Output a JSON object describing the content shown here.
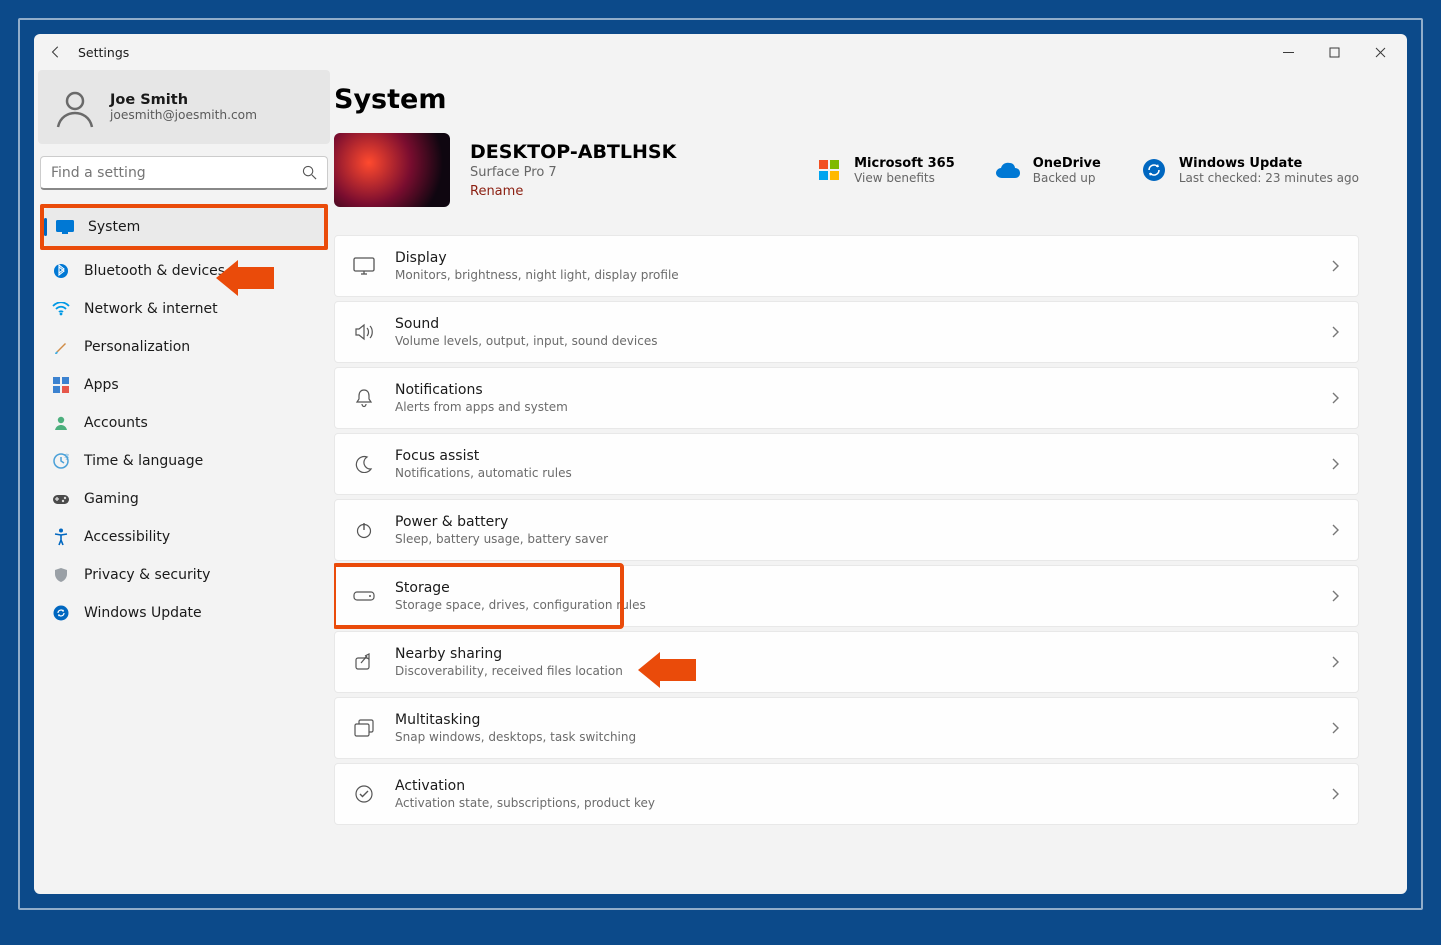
{
  "window": {
    "title": "Settings"
  },
  "profile": {
    "name": "Joe Smith",
    "email": "joesmith@joesmith.com"
  },
  "search": {
    "placeholder": "Find a setting"
  },
  "sidebar": {
    "items": [
      {
        "label": "System",
        "icon": "system",
        "active": true,
        "highlight": true
      },
      {
        "label": "Bluetooth & devices",
        "icon": "bluetooth"
      },
      {
        "label": "Network & internet",
        "icon": "wifi"
      },
      {
        "label": "Personalization",
        "icon": "brush"
      },
      {
        "label": "Apps",
        "icon": "apps"
      },
      {
        "label": "Accounts",
        "icon": "person"
      },
      {
        "label": "Time & language",
        "icon": "clock"
      },
      {
        "label": "Gaming",
        "icon": "gamepad"
      },
      {
        "label": "Accessibility",
        "icon": "accessibility"
      },
      {
        "label": "Privacy & security",
        "icon": "shield"
      },
      {
        "label": "Windows Update",
        "icon": "update"
      }
    ]
  },
  "page": {
    "title": "System"
  },
  "device": {
    "name": "DESKTOP-ABTLHSK",
    "model": "Surface Pro 7",
    "rename_label": "Rename"
  },
  "status": {
    "m365": {
      "title": "Microsoft 365",
      "sub": "View benefits"
    },
    "onedrive": {
      "title": "OneDrive",
      "sub": "Backed up"
    },
    "update": {
      "title": "Windows Update",
      "sub": "Last checked: 23 minutes ago"
    }
  },
  "settings": [
    {
      "title": "Display",
      "sub": "Monitors, brightness, night light, display profile",
      "icon": "display"
    },
    {
      "title": "Sound",
      "sub": "Volume levels, output, input, sound devices",
      "icon": "sound"
    },
    {
      "title": "Notifications",
      "sub": "Alerts from apps and system",
      "icon": "bell"
    },
    {
      "title": "Focus assist",
      "sub": "Notifications, automatic rules",
      "icon": "moon"
    },
    {
      "title": "Power & battery",
      "sub": "Sleep, battery usage, battery saver",
      "icon": "power"
    },
    {
      "title": "Storage",
      "sub": "Storage space, drives, configuration rules",
      "icon": "storage",
      "highlight": true
    },
    {
      "title": "Nearby sharing",
      "sub": "Discoverability, received files location",
      "icon": "share"
    },
    {
      "title": "Multitasking",
      "sub": "Snap windows, desktops, task switching",
      "icon": "multitask"
    },
    {
      "title": "Activation",
      "sub": "Activation state, subscriptions, product key",
      "icon": "check"
    }
  ]
}
